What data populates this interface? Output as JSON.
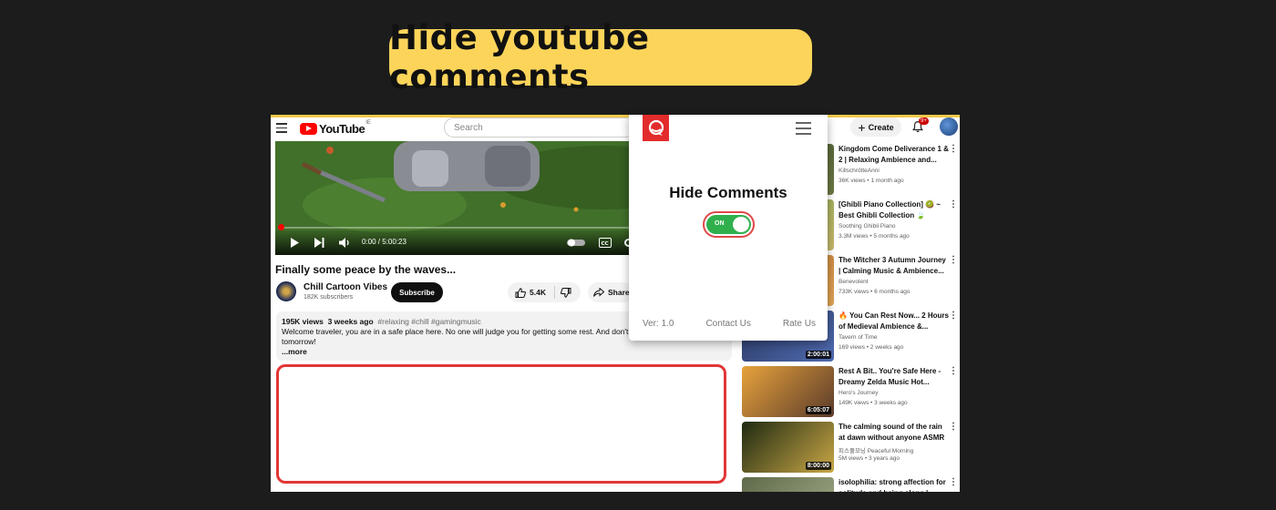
{
  "banner": {
    "title": "Hide youtube comments"
  },
  "colors": {
    "banner_bg": "#fcd45a",
    "accent_red": "#e23636",
    "toggle_on": "#2fb04d",
    "youtube_red": "#ff0000"
  },
  "topbar": {
    "logo_text": "YouTube",
    "logo_superscript": "IE",
    "search_placeholder": "Search",
    "create_label": "Create",
    "notification_count": "9+"
  },
  "player": {
    "time": "0:00 / 5:00:23",
    "progress": 0.0
  },
  "video": {
    "title": "Finally some peace by the waves...",
    "channel_name": "Chill Cartoon Vibes",
    "subscribers": "182K subscribers",
    "subscribe_label": "Subscribe",
    "likes": "5.4K",
    "share_label": "Share"
  },
  "description": {
    "views": "195K views",
    "age": "3 weeks ago",
    "tags": "#relaxing #chill #gamingmusic",
    "text": "Welcome traveler, you are in a safe place here. No one will judge you for getting some rest. And don't wo",
    "text_line2": "tomorrow!",
    "more_label": "...more"
  },
  "recommendations": [
    {
      "title": "Kingdom Come Deliverance 1 & 2 | Relaxing Ambience and...",
      "channel": "KillschrötteAnni",
      "meta": "36K views • 1 month ago",
      "duration": ""
    },
    {
      "title": "[Ghibli Piano Collection] 🥝 ~ Best Ghibli Collection 🍃 Love...",
      "channel": "Soothing Ghibli Piano",
      "meta": "3.3M views • 5 months ago",
      "duration": ""
    },
    {
      "title": "The Witcher 3 Autumn Journey | Calming Music & Ambience...",
      "channel": "Benevolent",
      "meta": "733K views • 6 months ago",
      "duration": ""
    },
    {
      "title": "🔥 You Can Rest Now... 2 Hours of Medieval Ambience &...",
      "channel": "Tavern of Time",
      "meta": "169 views • 2 weeks ago",
      "duration": "2:00:01"
    },
    {
      "title": "Rest A Bit.. You're Safe Here - Dreamy Zelda Music Hot...",
      "channel": "Hero's Journey",
      "meta": "149K views • 3 weeks ago",
      "duration": "6:05:07"
    },
    {
      "title": "The calming sound of the rain at dawn without anyone ASMR",
      "channel": "피스풀모닝 Peaceful Morning",
      "meta": "5M views • 3 years ago",
      "duration": "8:00:00"
    },
    {
      "title": "isolophilia: strong affection for solitude and being alone |...",
      "channel": "",
      "meta": "",
      "duration": ""
    }
  ],
  "popup": {
    "title": "Hide Comments",
    "toggle_label": "ON",
    "toggle_on": true,
    "version": "Ver: 1.0",
    "contact": "Contact Us",
    "rate": "Rate Us"
  }
}
